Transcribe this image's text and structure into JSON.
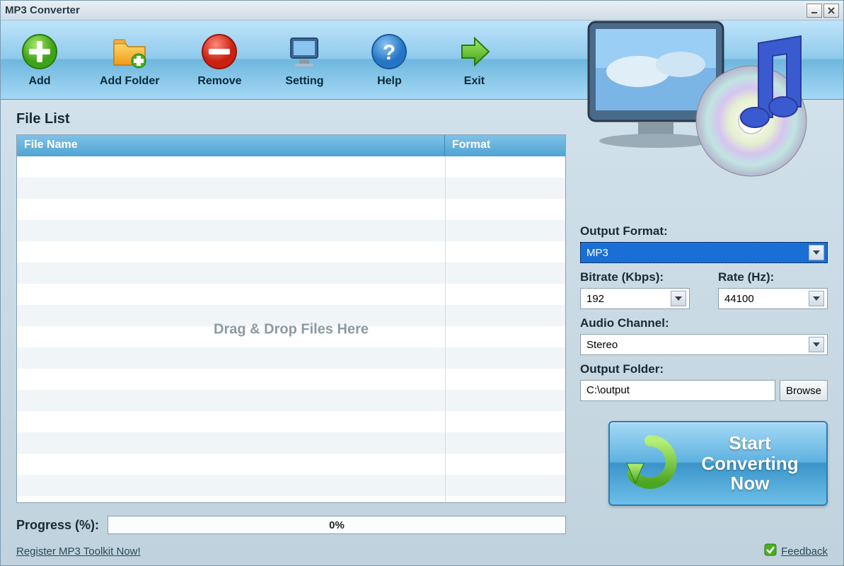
{
  "window": {
    "title": "MP3 Converter"
  },
  "toolbar": {
    "add": "Add",
    "add_folder": "Add Folder",
    "remove": "Remove",
    "setting": "Setting",
    "help": "Help",
    "exit": "Exit"
  },
  "file_list": {
    "title": "File List",
    "col_name": "File Name",
    "col_format": "Format",
    "drop_hint": "Drag & Drop Files Here"
  },
  "progress": {
    "label": "Progress (%):",
    "value": "0%"
  },
  "settings": {
    "output_format_label": "Output Format:",
    "output_format_value": "MP3",
    "bitrate_label": "Bitrate (Kbps):",
    "bitrate_value": "192",
    "rate_label": "Rate (Hz):",
    "rate_value": "44100",
    "channel_label": "Audio Channel:",
    "channel_value": "Stereo",
    "output_folder_label": "Output Folder:",
    "output_folder_value": "C:\\output",
    "browse": "Browse"
  },
  "start_button": "Start Converting Now",
  "footer": {
    "register": "Register MP3 Toolkit Now!",
    "feedback": "Feedback"
  }
}
